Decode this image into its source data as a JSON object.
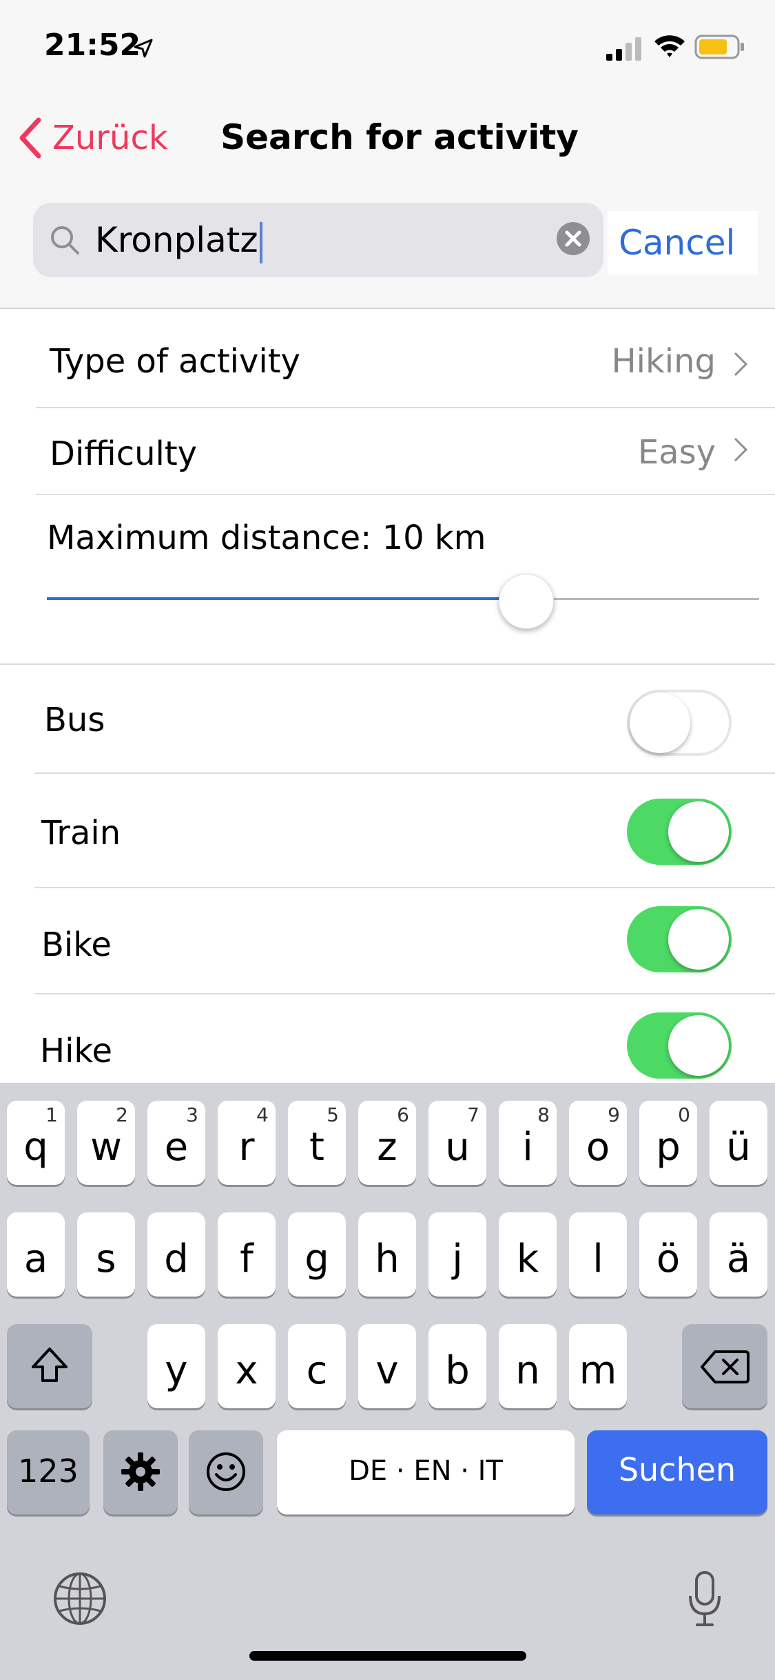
{
  "status_bar": {
    "time": "21:52"
  },
  "nav": {
    "back_label": "Zurück",
    "title": "Search for activity"
  },
  "search": {
    "value": "Kronplatz",
    "cancel_label": "Cancel"
  },
  "filters": {
    "type_label": "Type of activity",
    "type_value": "Hiking",
    "difficulty_label": "Difficulty",
    "difficulty_value": "Easy",
    "distance_label": "Maximum distance: 10 km",
    "distance_slider_fraction": 0.68
  },
  "transport": [
    {
      "label": "Bus",
      "enabled": false
    },
    {
      "label": "Train",
      "enabled": true
    },
    {
      "label": "Bike",
      "enabled": true
    },
    {
      "label": "Hike",
      "enabled": true
    }
  ],
  "keyboard": {
    "row1": [
      {
        "k": "q",
        "n": "1"
      },
      {
        "k": "w",
        "n": "2"
      },
      {
        "k": "e",
        "n": "3"
      },
      {
        "k": "r",
        "n": "4"
      },
      {
        "k": "t",
        "n": "5"
      },
      {
        "k": "z",
        "n": "6"
      },
      {
        "k": "u",
        "n": "7"
      },
      {
        "k": "i",
        "n": "8"
      },
      {
        "k": "o",
        "n": "9"
      },
      {
        "k": "p",
        "n": "0"
      },
      {
        "k": "ü",
        "n": ""
      }
    ],
    "row2": [
      "a",
      "s",
      "d",
      "f",
      "g",
      "h",
      "j",
      "k",
      "l",
      "ö",
      "ä"
    ],
    "row3": [
      "y",
      "x",
      "c",
      "v",
      "b",
      "n",
      "m"
    ],
    "numbers_label": "123",
    "space_label": "DE · EN · IT",
    "search_label": "Suchen"
  },
  "colors": {
    "accent_red": "#f0375e",
    "link_blue": "#2c6ddb",
    "toggle_green": "#4cd964"
  }
}
